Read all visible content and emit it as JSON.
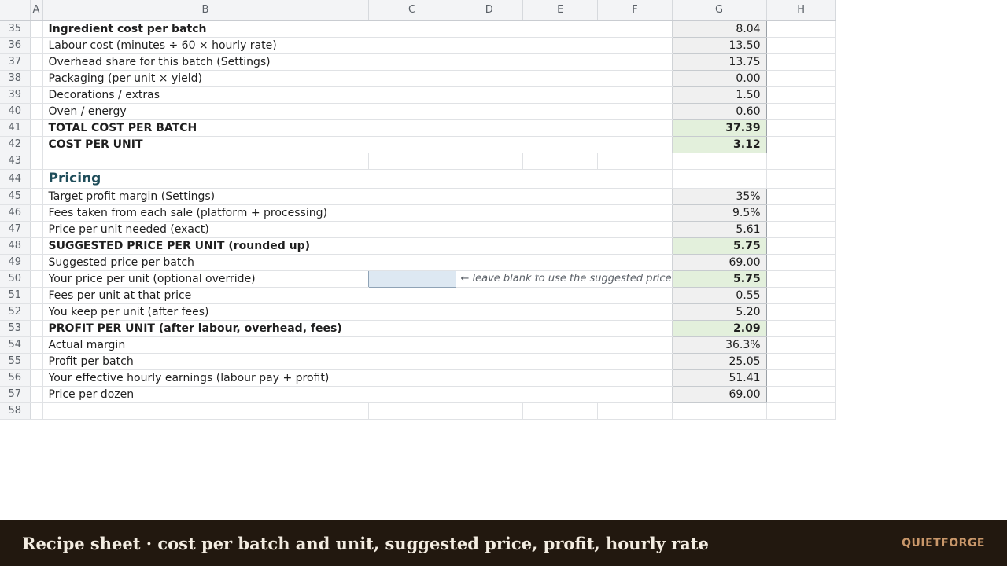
{
  "columns": [
    "A",
    "B",
    "C",
    "D",
    "E",
    "F",
    "G",
    "H"
  ],
  "rows": [
    {
      "num": "35",
      "label": "Ingredient cost per batch",
      "value": "8.04",
      "bold": true
    },
    {
      "num": "36",
      "label": "Labour cost (minutes ÷ 60 × hourly rate)",
      "value": "13.50"
    },
    {
      "num": "37",
      "label": "Overhead share for this batch (Settings)",
      "value": "13.75"
    },
    {
      "num": "38",
      "label": "Packaging (per unit × yield)",
      "value": "0.00"
    },
    {
      "num": "39",
      "label": "Decorations / extras",
      "value": "1.50"
    },
    {
      "num": "40",
      "label": "Oven / energy",
      "value": "0.60"
    },
    {
      "num": "41",
      "label": "TOTAL COST PER BATCH",
      "value": "37.39",
      "bold": true,
      "total": true
    },
    {
      "num": "42",
      "label": "COST PER UNIT",
      "value": "3.12",
      "bold": true,
      "total": true
    },
    {
      "num": "43",
      "empty": true
    },
    {
      "num": "44",
      "heading": "Pricing"
    },
    {
      "num": "45",
      "label": "Target profit margin (Settings)",
      "value": "35%"
    },
    {
      "num": "46",
      "label": "Fees taken from each sale (platform + processing)",
      "value": "9.5%"
    },
    {
      "num": "47",
      "label": "Price per unit needed (exact)",
      "value": "5.61"
    },
    {
      "num": "48",
      "label": "SUGGESTED PRICE PER UNIT (rounded up)",
      "value": "5.75",
      "bold": true,
      "total": true
    },
    {
      "num": "49",
      "label": "Suggested price per batch",
      "value": "69.00"
    },
    {
      "num": "50",
      "label": "Your price per unit (optional override)",
      "value": "5.75",
      "total": true,
      "input": "",
      "note": "← leave blank to use the suggested price"
    },
    {
      "num": "51",
      "label": "Fees per unit at that price",
      "value": "0.55"
    },
    {
      "num": "52",
      "label": "You keep per unit (after fees)",
      "value": "5.20"
    },
    {
      "num": "53",
      "label": "PROFIT PER UNIT (after labour, overhead, fees)",
      "value": "2.09",
      "bold": true,
      "total": true
    },
    {
      "num": "54",
      "label": "Actual margin",
      "value": "36.3%"
    },
    {
      "num": "55",
      "label": "Profit per batch",
      "value": "25.05"
    },
    {
      "num": "56",
      "label": "Your effective hourly earnings (labour pay + profit)",
      "value": "51.41"
    },
    {
      "num": "57",
      "label": "Price per dozen",
      "value": "69.00"
    },
    {
      "num": "58",
      "empty": true
    }
  ],
  "footer": {
    "title": "Recipe sheet · cost per batch and unit, suggested price, profit, hourly rate",
    "brand": "QUIETFORGE"
  },
  "colors": {
    "header_bg": "#f3f4f6",
    "total_fill": "#e3f0dc",
    "value_fill": "#f0f0f0",
    "input_fill": "#dde8f2",
    "heading": "#1f4d5a",
    "footer_bg": "#22180f",
    "footer_brand": "#c9976a"
  }
}
